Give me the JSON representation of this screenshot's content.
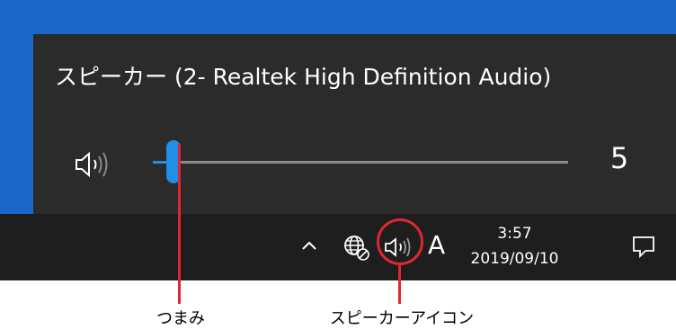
{
  "flyout": {
    "device_name": "スピーカー (2- Realtek High Definition Audio)",
    "volume_value": "5",
    "volume_level_percent": 5
  },
  "taskbar": {
    "ime_indicator": "A",
    "clock_time": "3:57",
    "clock_date": "2019/09/10"
  },
  "annotations": {
    "thumb_label": "つまみ",
    "speaker_icon_label": "スピーカーアイコン"
  },
  "icons": {
    "flyout_speaker": "speaker-icon",
    "tray_chevron": "chevron-up-icon",
    "tray_network": "globe-network-icon",
    "tray_speaker": "speaker-icon",
    "action_center": "notification-icon"
  },
  "colors": {
    "accent": "#1f8fe8",
    "desktop": "#1b66c9",
    "flyout_bg": "#2b2b2b",
    "taskbar_bg": "#1e1e1e",
    "annotation": "#e2262d"
  }
}
